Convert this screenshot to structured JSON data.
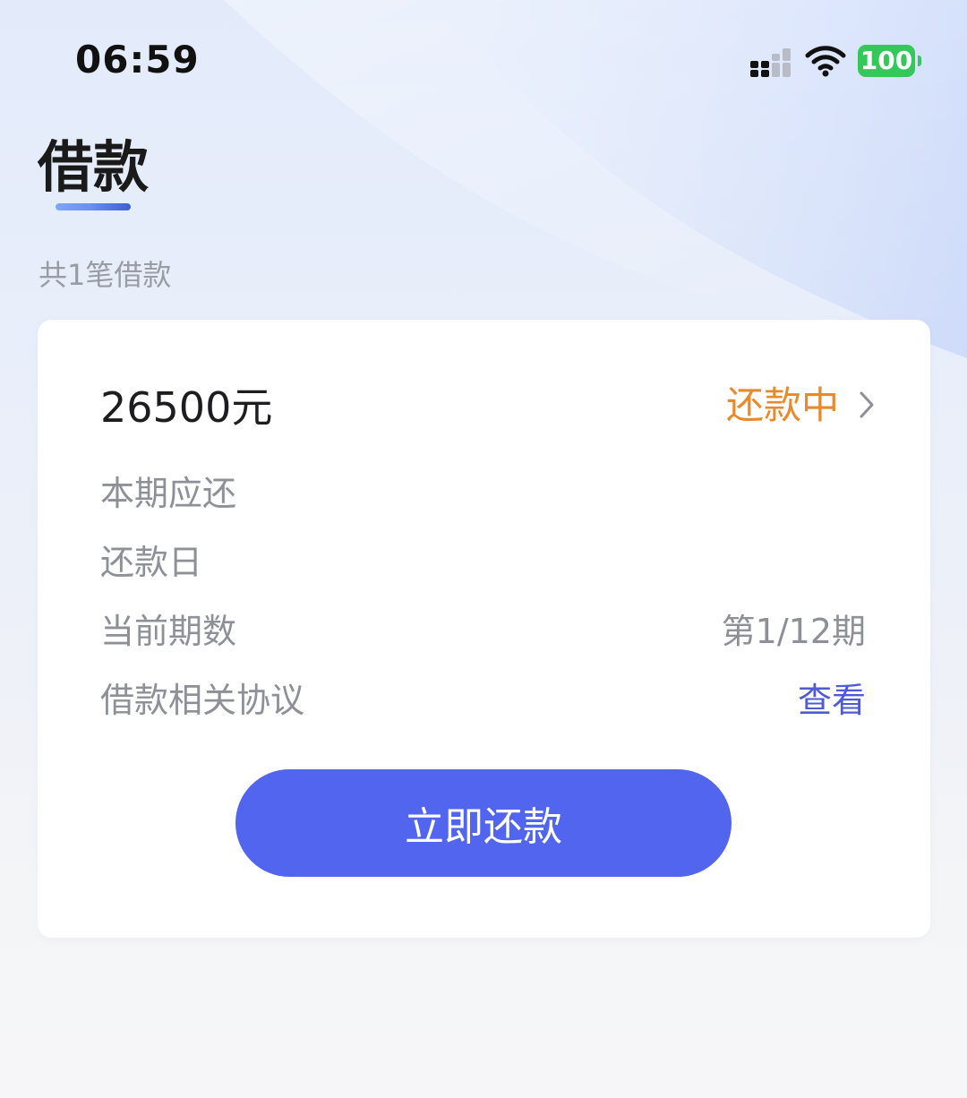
{
  "status_bar": {
    "time": "06:59",
    "battery": "100",
    "signal_icon": "cellular-signal-icon",
    "wifi_icon": "wifi-icon"
  },
  "page": {
    "title": "借款",
    "loan_count_text": "共1笔借款"
  },
  "loan_card": {
    "amount": "26500元",
    "status": "还款中",
    "status_icon": "chevron-right-icon",
    "rows": [
      {
        "label": "本期应还",
        "value": ""
      },
      {
        "label": "还款日",
        "value": ""
      },
      {
        "label": "当前期数",
        "value": "第1/12期"
      },
      {
        "label": "借款相关协议",
        "value": "查看"
      }
    ],
    "repay_button_label": "立即还款"
  },
  "colors": {
    "accent_blue": "#5265ee",
    "status_orange": "#e8892c",
    "link_blue": "#4f5ad6",
    "battery_green": "#34c759"
  }
}
